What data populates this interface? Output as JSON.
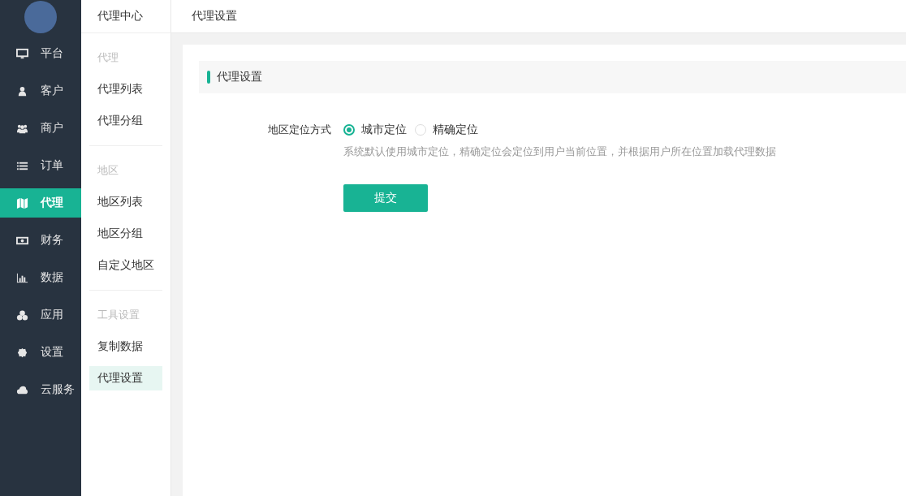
{
  "nav": {
    "items": [
      {
        "label": "平台",
        "selected": false
      },
      {
        "label": "客户",
        "selected": false
      },
      {
        "label": "商户",
        "selected": false
      },
      {
        "label": "订单",
        "selected": false
      },
      {
        "label": "代理",
        "selected": true
      },
      {
        "label": "财务",
        "selected": false
      },
      {
        "label": "数据",
        "selected": false
      },
      {
        "label": "应用",
        "selected": false
      },
      {
        "label": "设置",
        "selected": false
      },
      {
        "label": "云服务",
        "selected": false
      }
    ]
  },
  "subnav": {
    "title": "代理中心",
    "groups": [
      {
        "title": "代理",
        "items": [
          {
            "label": "代理列表",
            "selected": false
          },
          {
            "label": "代理分组",
            "selected": false
          }
        ]
      },
      {
        "title": "地区",
        "items": [
          {
            "label": "地区列表",
            "selected": false
          },
          {
            "label": "地区分组",
            "selected": false
          },
          {
            "label": "自定义地区",
            "selected": false
          }
        ]
      },
      {
        "title": "工具设置",
        "items": [
          {
            "label": "复制数据",
            "selected": false
          },
          {
            "label": "代理设置",
            "selected": true
          }
        ]
      }
    ]
  },
  "topbar": {
    "title": "代理设置"
  },
  "panel": {
    "title": "代理设置",
    "field": {
      "label": "地区定位方式",
      "options": [
        {
          "label": "城市定位",
          "selected": true
        },
        {
          "label": "精确定位",
          "selected": false
        }
      ],
      "help": "系统默认使用城市定位，精确定位会定位到用户当前位置，并根据用户所在位置加载代理数据"
    },
    "submit": "提交"
  }
}
